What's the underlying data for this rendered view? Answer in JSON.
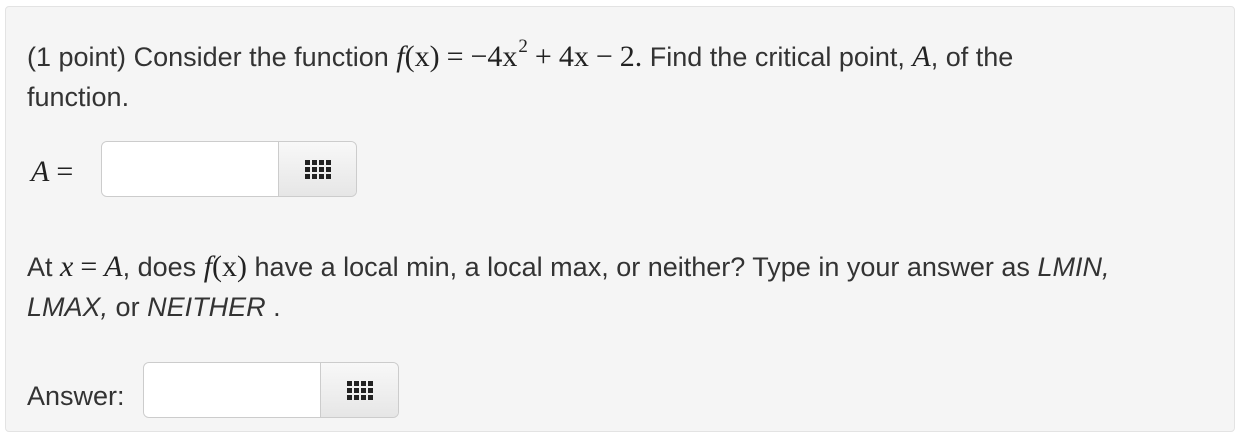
{
  "problem": {
    "points": "(1 point)",
    "intro": "Consider the function",
    "function_name": "f",
    "function_arg": "(x)",
    "equals": "=",
    "term1": "−4x",
    "term1_exp": "2",
    "plus": "+",
    "term2": "4x",
    "minus": "−",
    "term3": "2.",
    "find_text": "Find the critical point,",
    "critical_point_var": "A",
    "find_tail": ", of the",
    "line2": "function."
  },
  "input_a": {
    "label_var": "A",
    "label_eq": "=",
    "value": "",
    "palette_icon": "grid-icon"
  },
  "question2": {
    "at": "At",
    "x_var": "x",
    "eq": "=",
    "a_var": "A",
    "does": ", does",
    "f_name": "f",
    "f_arg": "(x)",
    "rest": "have a local min, a local max, or neither? Type in your answer as",
    "opt1": "LMIN,",
    "opt2": "LMAX,",
    "or": "or",
    "opt3": "NEITHER",
    "period": "."
  },
  "input_answer": {
    "label": "Answer:",
    "value": "",
    "palette_icon": "grid-icon"
  }
}
